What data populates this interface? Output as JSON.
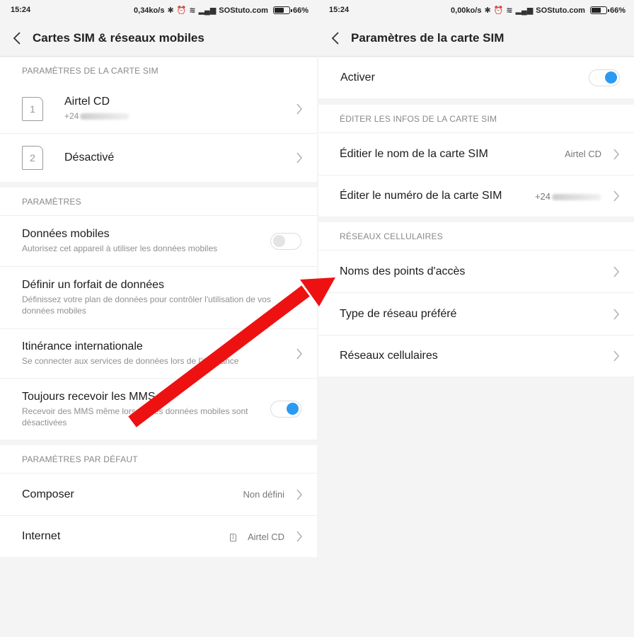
{
  "left": {
    "status": {
      "time": "15:24",
      "speed": "0,34ko/s",
      "carrier": "SOStuto.com",
      "battery": "66%",
      "battery_level": 0.66
    },
    "title": "Cartes SIM & réseaux mobiles",
    "sim_section": {
      "header": "PARAMÈTRES DE LA CARTE SIM",
      "sims": [
        {
          "slot": "1",
          "name": "Airtel CD",
          "number": "+24"
        },
        {
          "slot": "2",
          "name": "Désactivé"
        }
      ]
    },
    "params_section": {
      "header": "PARAMÈTRES",
      "items": [
        {
          "title": "Données mobiles",
          "subtitle": "Autorisez cet appareil à utiliser les données mobiles",
          "toggle": "off"
        },
        {
          "title": "Définir un forfait de données",
          "subtitle": "Définissez votre plan de données pour contrôler l'utilisation de vos données mobiles"
        },
        {
          "title": "Itinérance internationale",
          "subtitle": "Se connecter aux services de données lors de l'itinérance"
        },
        {
          "title": "Toujours recevoir les MMS",
          "subtitle": "Recevoir des MMS même lorsque les données mobiles sont désactivées",
          "toggle": "on"
        }
      ]
    },
    "default_section": {
      "header": "PARAMÈTRES PAR DÉFAUT",
      "items": [
        {
          "title": "Composer",
          "value": "Non défini"
        },
        {
          "title": "Internet",
          "value": "Airtel CD",
          "sim_slot": "1"
        }
      ]
    }
  },
  "right": {
    "status": {
      "time": "15:24",
      "speed": "0,00ko/s",
      "carrier": "SOStuto.com",
      "battery": "66%",
      "battery_level": 0.66
    },
    "title": "Paramètres de la carte SIM",
    "activate": {
      "title": "Activer",
      "toggle": "on"
    },
    "edit_section": {
      "header": "ÉDITER LES INFOS DE LA CARTE SIM",
      "items": [
        {
          "title": "Éditier le nom de la carte SIM",
          "value": "Airtel CD"
        },
        {
          "title": "Éditer le numéro de la carte SIM",
          "value": "+24"
        }
      ]
    },
    "cellular_section": {
      "header": "RÉSEAUX CELLULAIRES",
      "items": [
        {
          "title": "Noms des points d'accès"
        },
        {
          "title": "Type de réseau préféré"
        },
        {
          "title": "Réseaux cellulaires"
        }
      ]
    }
  },
  "colors": {
    "accent": "#2b9af3",
    "arrow": "#ee1111",
    "background": "#f4f4f4",
    "card": "#ffffff"
  },
  "icons": [
    "back-icon",
    "chevron-right-icon",
    "bluetooth-icon",
    "alarm-icon",
    "wifi-icon",
    "signal-icon",
    "battery-icon",
    "sim-card-icon"
  ]
}
